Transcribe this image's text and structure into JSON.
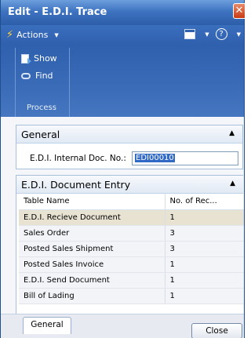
{
  "window": {
    "title": "Edit - E.D.I. Trace",
    "close_glyph": "✕"
  },
  "actionbar": {
    "actions_label": "Actions",
    "help_glyph": "?"
  },
  "ribbon": {
    "items": [
      {
        "label": "Show",
        "icon": "show-icon"
      },
      {
        "label": "Find",
        "icon": "find-icon"
      }
    ],
    "group_label": "Process"
  },
  "general": {
    "title": "General",
    "field_label": "E.D.I. Internal Doc. No.:",
    "field_value": "EDI00010"
  },
  "entry": {
    "title": "E.D.I. Document Entry",
    "columns": [
      "Table Name",
      "No. of Rec..."
    ],
    "rows": [
      {
        "table_name": "E.D.I. Recieve Document",
        "count": "1"
      },
      {
        "table_name": "Sales Order",
        "count": "3"
      },
      {
        "table_name": "Posted Sales Shipment",
        "count": "3"
      },
      {
        "table_name": "Posted Sales Invoice",
        "count": "1"
      },
      {
        "table_name": "E.D.I. Send Document",
        "count": "1"
      },
      {
        "table_name": "Bill of Lading",
        "count": "1"
      }
    ]
  },
  "footer": {
    "tab_label": "General",
    "close_label": "Close"
  }
}
